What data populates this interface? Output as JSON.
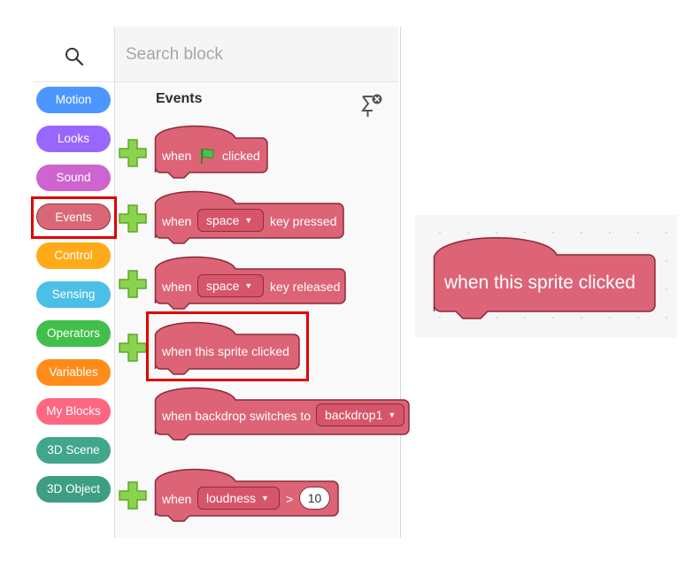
{
  "search": {
    "placeholder": "Search block"
  },
  "categories": [
    {
      "label": "Motion",
      "color": "#4c97ff"
    },
    {
      "label": "Looks",
      "color": "#9966ff"
    },
    {
      "label": "Sound",
      "color": "#cf63cf"
    },
    {
      "label": "Events",
      "color": "#d86878"
    },
    {
      "label": "Control",
      "color": "#ffab19"
    },
    {
      "label": "Sensing",
      "color": "#4cbfe6"
    },
    {
      "label": "Operators",
      "color": "#40bf4a"
    },
    {
      "label": "Variables",
      "color": "#ff8c1a"
    },
    {
      "label": "My Blocks",
      "color": "#ff6680"
    },
    {
      "label": "3D Scene",
      "color": "#40a68c"
    },
    {
      "label": "3D Object",
      "color": "#3d9e84"
    }
  ],
  "selected_category": "Events",
  "palette": {
    "section_title": "Events",
    "blocks": {
      "flag_clicked": {
        "pre": "when",
        "post": "clicked"
      },
      "key_pressed": {
        "pre": "when",
        "dropdown": "space",
        "post": "key pressed"
      },
      "key_released": {
        "pre": "when",
        "dropdown": "space",
        "post": "key released"
      },
      "sprite_clicked": {
        "text": "when this sprite clicked"
      },
      "backdrop_switches": {
        "pre": "when backdrop switches to",
        "dropdown": "backdrop1"
      },
      "loudness": {
        "pre": "when",
        "dropdown": "loudness",
        "op": ">",
        "value": "10"
      }
    }
  },
  "preview": {
    "text": "when this sprite clicked"
  },
  "colors": {
    "block_fill": "#dc6476",
    "block_stroke": "#8c2a3a",
    "highlight": "#e00000",
    "add_icon": "#7ac943"
  },
  "icons": {
    "search": "search-icon",
    "pin": "pin-icon",
    "flag": "green-flag-icon",
    "add": "plus-icon"
  }
}
